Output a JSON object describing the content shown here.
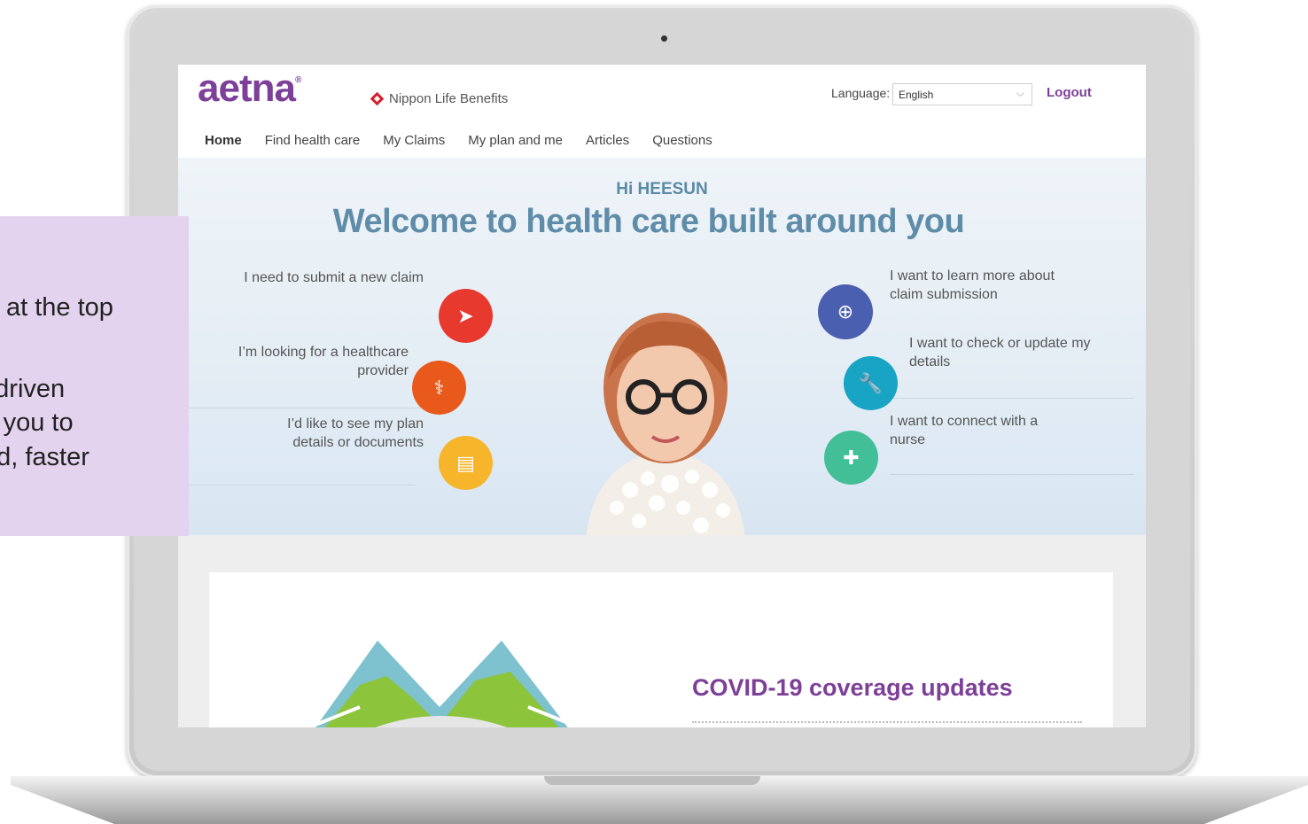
{
  "header": {
    "logo": "aetna",
    "partner": "Nippon Life Benefits",
    "language_label": "Language:",
    "language_value": "English",
    "logout": "Logout"
  },
  "nav": {
    "items": [
      "Home",
      "Find health care",
      "My Claims",
      "My plan and me",
      "Articles",
      "Questions"
    ]
  },
  "hero": {
    "greeting": "Hi HEESUN",
    "welcome": "Welcome to health care built around you",
    "left_actions": [
      {
        "label": "I need to submit a new claim",
        "icon": "paper-plane-icon",
        "color": "#e8392f"
      },
      {
        "label": "I’m looking for a healthcare provider",
        "icon": "caduceus-icon",
        "color": "#e8591b"
      },
      {
        "label": "I’d like to see my plan details or documents",
        "icon": "document-icon",
        "color": "#f7b52b"
      }
    ],
    "right_actions": [
      {
        "label": "I want to learn more about claim submission",
        "icon": "claim-info-icon",
        "color": "#4a5fb0"
      },
      {
        "label": "I want to check or update my details",
        "icon": "wrench-icon",
        "color": "#18a4c4"
      },
      {
        "label": "I want to connect with a nurse",
        "icon": "bandage-icon",
        "color": "#43bf98"
      }
    ]
  },
  "covid": {
    "title": "COVID-19 coverage updates"
  },
  "callout": {
    "line1": "at the top",
    "line2": "k-driven",
    "line3": "ts you to",
    "line4": "ed, faster"
  },
  "colors": {
    "brand": "#7d3f98",
    "hero_text": "#5f8ca8",
    "callout_bg": "#e3d3ee"
  }
}
